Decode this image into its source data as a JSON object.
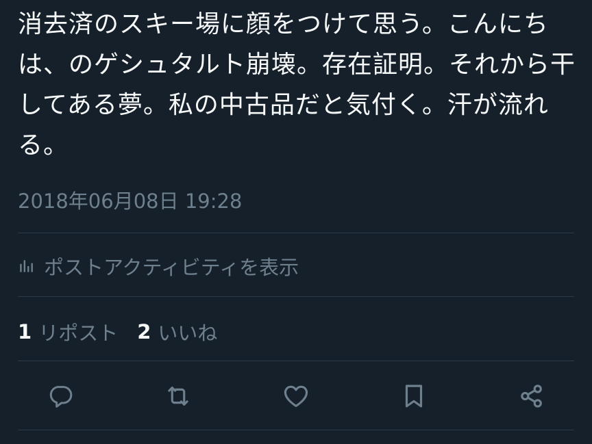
{
  "tweet": {
    "text": "消去済のスキー場に顔をつけて思う。こんにちは、のゲシュタルト崩壊。存在証明。それから干してある夢。私の中古品だと気付く。汗が流れる。",
    "timestamp": "2018年06月08日 19:28"
  },
  "activity": {
    "label": "ポストアクティビティを表示",
    "icon": "bar-chart-icon"
  },
  "stats": {
    "reposts_count": "1",
    "reposts_label": "リポスト",
    "likes_count": "2",
    "likes_label": "いいね"
  },
  "actions": [
    {
      "name": "reply",
      "icon": "reply-icon"
    },
    {
      "name": "repost",
      "icon": "repost-icon"
    },
    {
      "name": "like",
      "icon": "heart-icon"
    },
    {
      "name": "bookmark",
      "icon": "bookmark-icon"
    },
    {
      "name": "share",
      "icon": "share-icon"
    }
  ],
  "colors": {
    "background": "#15202b",
    "text_primary": "#f7f9f9",
    "text_secondary": "#6e7f8d",
    "divider": "#2c3b49",
    "icon": "#6e7f8d"
  }
}
